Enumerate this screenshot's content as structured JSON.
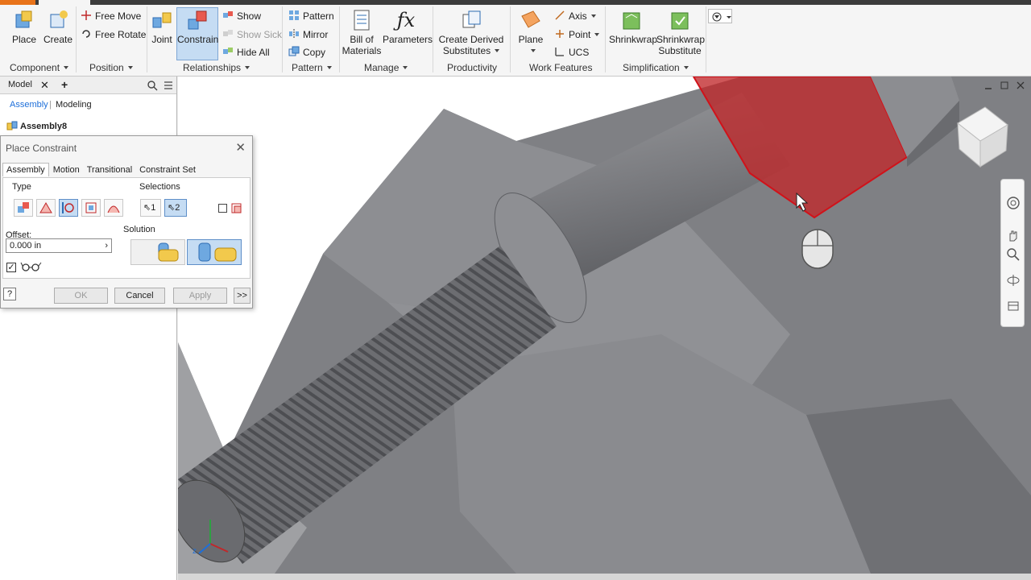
{
  "ribbon": {
    "component": {
      "place": "Place",
      "create": "Create",
      "group": "Component"
    },
    "position": {
      "free_move": "Free Move",
      "free_rotate": "Free Rotate",
      "group": "Position"
    },
    "relationships": {
      "joint": "Joint",
      "constrain": "Constrain",
      "show": "Show",
      "show_sick": "Show Sick",
      "hide_all": "Hide All",
      "group": "Relationships"
    },
    "pattern": {
      "pattern": "Pattern",
      "mirror": "Mirror",
      "copy": "Copy",
      "group": "Pattern"
    },
    "manage": {
      "bill_line1": "Bill of",
      "bill_line2": "Materials",
      "parameters": "Parameters",
      "group": "Manage"
    },
    "productivity": {
      "derived_line1": "Create Derived",
      "derived_line2": "Substitutes",
      "group": "Productivity"
    },
    "work_features": {
      "plane": "Plane",
      "axis": "Axis",
      "point": "Point",
      "ucs": "UCS",
      "group": "Work Features"
    },
    "simplification": {
      "shrinkwrap": "Shrinkwrap",
      "shrinkwrap_sub_line1": "Shrinkwrap",
      "shrinkwrap_sub_line2": "Substitute",
      "group": "Simplification"
    }
  },
  "browser": {
    "tab_model": "Model",
    "sub_assembly": "Assembly",
    "sub_modeling": "Modeling",
    "root": "Assembly8"
  },
  "dialog": {
    "title": "Place Constraint",
    "tabs": [
      "Assembly",
      "Motion",
      "Transitional",
      "Constraint Set"
    ],
    "type_label": "Type",
    "selections_label": "Selections",
    "sel1": "1",
    "sel2": "2",
    "offset_label": "Offset:",
    "offset_value": "0.000 in",
    "solution_label": "Solution",
    "ok": "OK",
    "cancel": "Cancel",
    "apply": "Apply",
    "more": ">>"
  },
  "colors": {
    "accent_blue": "#1e6fd9",
    "selection_red": "#c0282a",
    "file_orange": "#e8731a"
  }
}
